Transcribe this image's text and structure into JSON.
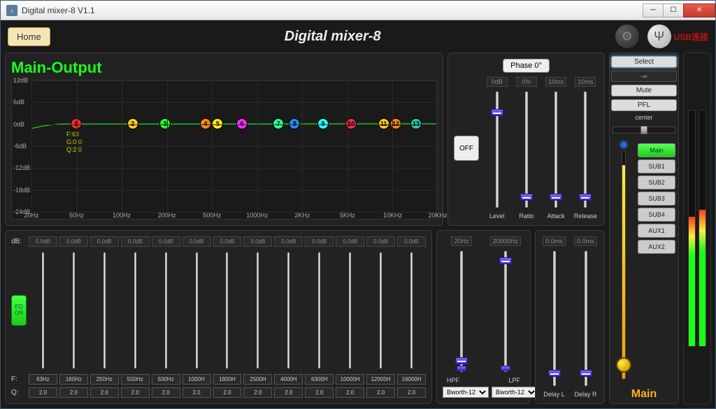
{
  "window": {
    "title": "Digital mixer-8 V1.1"
  },
  "header": {
    "home": "Home",
    "app_title": "Digital mixer-8",
    "usb_status": "USB连接"
  },
  "section_title": "Main-Output",
  "eq_graph": {
    "y_ticks": [
      "12dB",
      "6dB",
      "0dB",
      "-6dB",
      "-12dB",
      "-18dB",
      "-24dB"
    ],
    "x_ticks": [
      "20Hz",
      "50Hz",
      "100Hz",
      "200Hz",
      "500Hz",
      "1000Hz",
      "2KHz",
      "5KHz",
      "10KHz",
      "20KHz"
    ],
    "nodes": [
      {
        "n": "1",
        "color": "#ff2a2a",
        "x": 11
      },
      {
        "n": "2",
        "color": "#ffcc1a",
        "x": 25
      },
      {
        "n": "3",
        "color": "#2aff2a",
        "x": 33
      },
      {
        "n": "4",
        "color": "#ff8a1a",
        "x": 43
      },
      {
        "n": "5",
        "color": "#ffee1a",
        "x": 46
      },
      {
        "n": "6",
        "color": "#ff2aff",
        "x": 52
      },
      {
        "n": "7",
        "color": "#2aff8a",
        "x": 61
      },
      {
        "n": "8",
        "color": "#2a8aff",
        "x": 65
      },
      {
        "n": "9",
        "color": "#2affff",
        "x": 72
      },
      {
        "n": "10",
        "color": "#ff2a4a",
        "x": 79
      },
      {
        "n": "11",
        "color": "#ffcc1a",
        "x": 87
      },
      {
        "n": "12",
        "color": "#ff8a1a",
        "x": 90
      },
      {
        "n": "13",
        "color": "#2accaa",
        "x": 95
      }
    ],
    "tooltip": "F:63\nG:0.0\nQ:2.0"
  },
  "compressor": {
    "phase": "Phase 0°",
    "off": "OFF",
    "params": [
      {
        "val": "0dB",
        "lab": "Level",
        "pos": 15
      },
      {
        "val": "0%",
        "lab": "Ratio",
        "pos": 88
      },
      {
        "val": "10ms",
        "lab": "Attack",
        "pos": 88
      },
      {
        "val": "10ms",
        "lab": "Release",
        "pos": 88
      }
    ]
  },
  "eq_bands": {
    "db_label": "dB:",
    "eq_on": "EQ\nON",
    "f_label": "F:",
    "q_label": "Q:",
    "bands": [
      {
        "db": "0.0dB",
        "f": "63Hz",
        "q": "2.0"
      },
      {
        "db": "0.0dB",
        "f": "160Hz",
        "q": "2.0"
      },
      {
        "db": "0.0dB",
        "f": "250Hz",
        "q": "2.0"
      },
      {
        "db": "0.0dB",
        "f": "500Hz",
        "q": "2.0"
      },
      {
        "db": "0.0dB",
        "f": "630Hz",
        "q": "2.0"
      },
      {
        "db": "0.0dB",
        "f": "1000H",
        "q": "2.0"
      },
      {
        "db": "0.0dB",
        "f": "1800H",
        "q": "2.0"
      },
      {
        "db": "0.0dB",
        "f": "2500H",
        "q": "2.0"
      },
      {
        "db": "0.0dB",
        "f": "4000H",
        "q": "2.0"
      },
      {
        "db": "0.0dB",
        "f": "6300H",
        "q": "2.0"
      },
      {
        "db": "0.0dB",
        "f": "10000H",
        "q": "2.0"
      },
      {
        "db": "0.0dB",
        "f": "12000H",
        "q": "2.0"
      },
      {
        "db": "0.0dB",
        "f": "16000H",
        "q": "2.0"
      }
    ]
  },
  "filter": {
    "hpf_val": "20Hz",
    "lpf_val": "20000Hz",
    "hpf_lab": "HPF",
    "lpf_lab": "LPF",
    "type": "Bworth-12"
  },
  "delay": {
    "l_val": "0.0ms",
    "r_val": "0.0ms",
    "l_lab": "Delay L",
    "r_lab": "Delay R"
  },
  "right": {
    "select": "Select",
    "level": "-∞",
    "mute": "Mute",
    "pfl": "PFL",
    "center": "center",
    "buses": [
      "Main",
      "SUB1",
      "SUB2",
      "SUB3",
      "SUB4",
      "AUX1",
      "AUX2"
    ],
    "main_label": "Main",
    "fader_pos": 6,
    "meter_l": 55,
    "meter_r": 58
  }
}
